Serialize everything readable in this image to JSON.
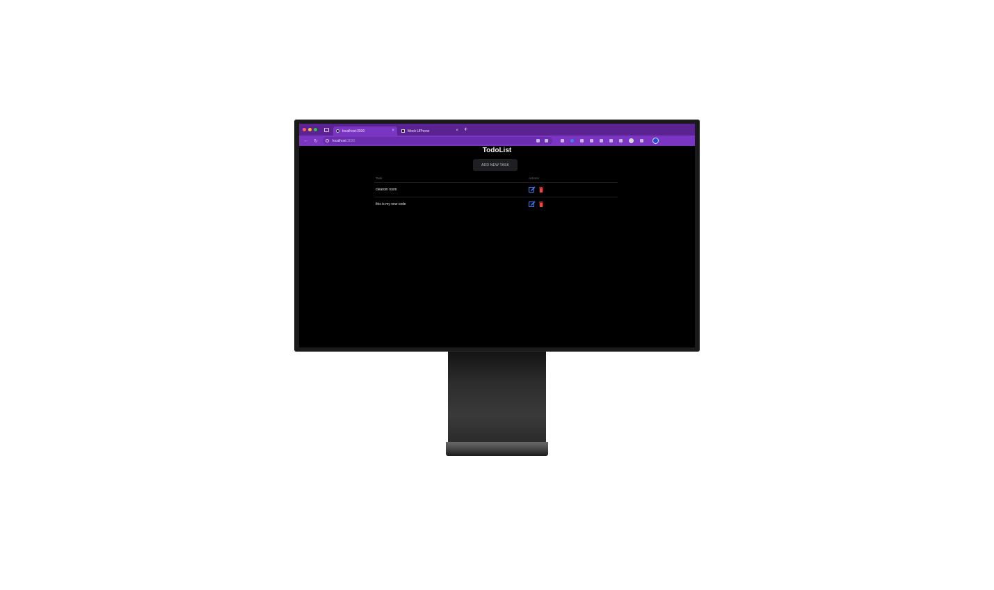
{
  "browser": {
    "tabs": [
      {
        "label": "localhost:3030",
        "close": "×",
        "active": true
      },
      {
        "label": "Mock UPhone",
        "close": "×",
        "active": false
      }
    ],
    "new_tab": "+",
    "url": {
      "host": "localhost",
      "port": ":3030"
    },
    "icons": {
      "back": "←",
      "reload": "↻"
    }
  },
  "app": {
    "title": "TodoList",
    "add_button": "ADD NEW TASK",
    "table": {
      "headers": {
        "task": "Task",
        "actions": "Actions"
      },
      "rows": [
        {
          "task": "clearom room"
        },
        {
          "task": "this is my new code"
        }
      ]
    }
  },
  "colors": {
    "tabbar": "#5b2291",
    "toolbar": "#7a36c2",
    "edit": "#3b82f6",
    "delete": "#ef4444"
  }
}
